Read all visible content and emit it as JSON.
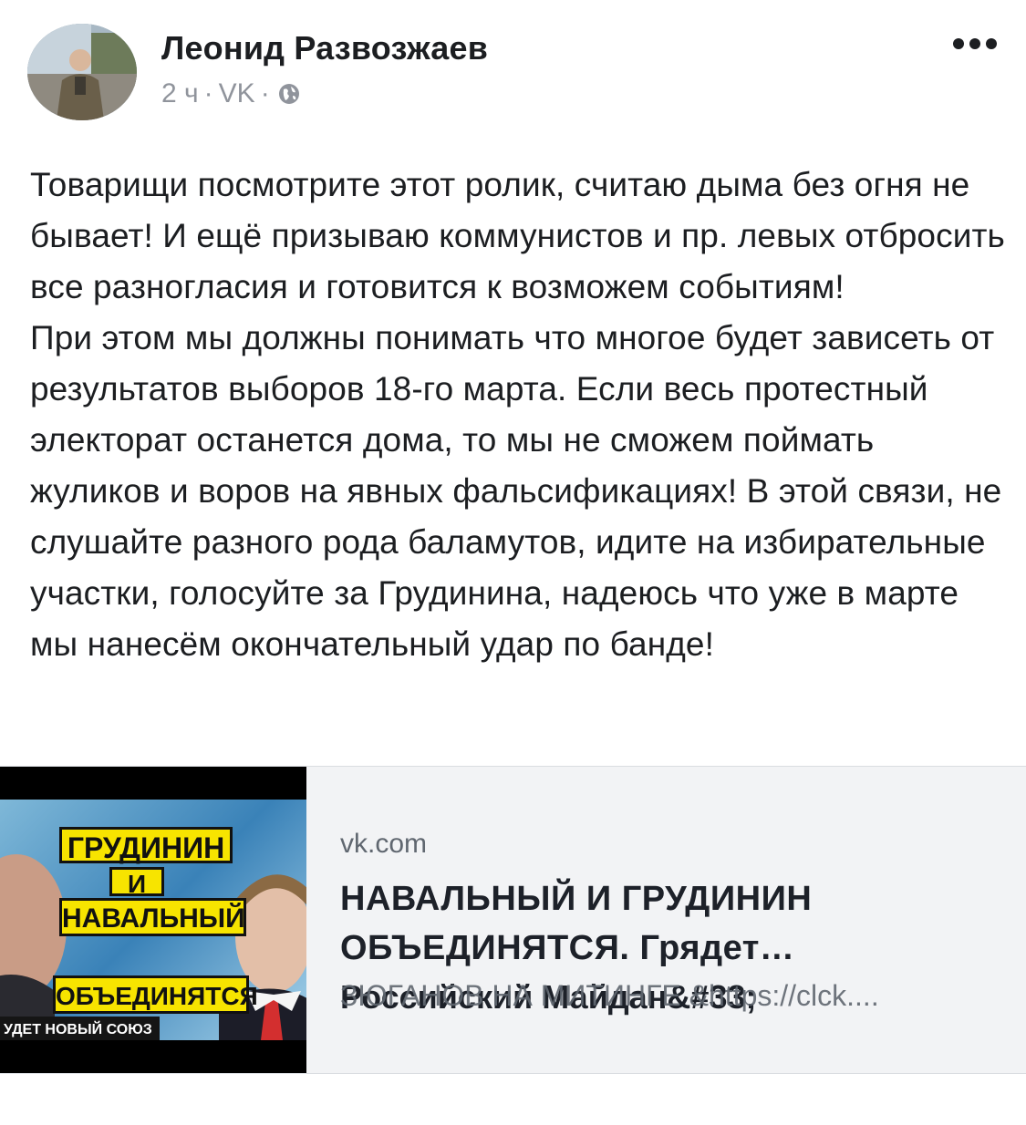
{
  "post": {
    "author": "Леонид Развозжаев",
    "time": "2 ч",
    "separator": "·",
    "source": "VK",
    "privacy_icon": "globe-icon",
    "more_icon": "more-options-icon",
    "paragraphs": [
      "Товарищи посмотрите этот ролик, считаю дыма без огня не бывает! И ещё призываю коммунистов и пр. левых отбросить все разногласия и готовится к возможем событиям!",
      "При этом мы должны понимать что многое будет зависеть от результатов выборов 18-го марта. Если весь протестный электорат останется дома, то мы не сможем поймать жуликов и воров на явных фальсификациях! В этой связи, не слушайте разного рода баламутов, идите на избирательные участки, голосуйте за Грудинина, надеюсь что уже в марте мы нанесём окончательный удар по банде!"
    ]
  },
  "link_preview": {
    "domain": "vk.com",
    "title": "НАВАЛЬНЫЙ И ГРУДИНИН ОБЪЕДИНЯТСЯ. Грядет…",
    "subtitle_overlap_a": "Российский Майдан&#33;",
    "subtitle_overlap_b": "ЗЮГАНОВ НА МИТИНГЕ &https://clck....",
    "thumbnail": {
      "line1": "ГРУДИНИН",
      "line2": "И",
      "line3": "НАВАЛЬНЫЙ",
      "line4": "ОБЪЕДИНЯТСЯ",
      "strip": "УДЕТ НОВЫЙ СОЮЗ"
    }
  }
}
